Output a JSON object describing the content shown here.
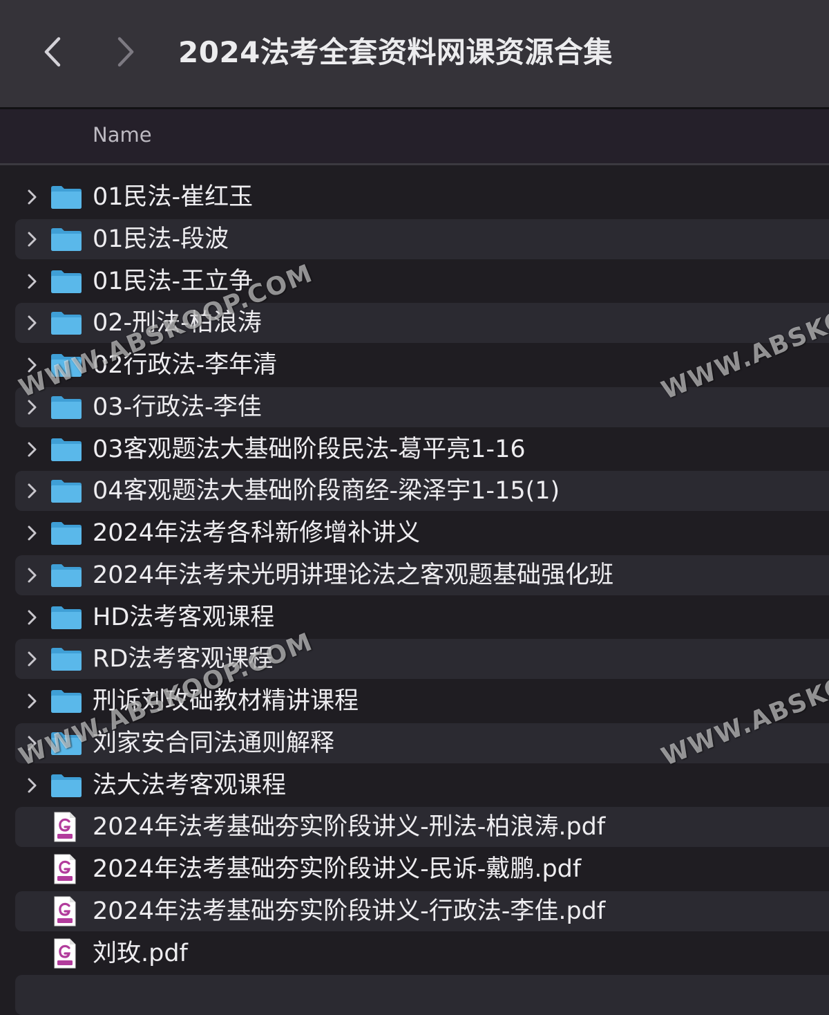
{
  "window": {
    "title": "2024法考全套资料网课资源合集"
  },
  "header": {
    "name_label": "Name"
  },
  "items": [
    {
      "name": "01民法-崔红玉",
      "kind": "folder"
    },
    {
      "name": "01民法-段波",
      "kind": "folder"
    },
    {
      "name": "01民法-王立争",
      "kind": "folder"
    },
    {
      "name": "02-刑法-柏浪涛",
      "kind": "folder"
    },
    {
      "name": "02行政法-李年清",
      "kind": "folder"
    },
    {
      "name": "03-行政法-李佳",
      "kind": "folder"
    },
    {
      "name": "03客观题法大基础阶段民法-葛平亮1-16",
      "kind": "folder"
    },
    {
      "name": "04客观题法大基础阶段商经-梁泽宇1-15(1)",
      "kind": "folder"
    },
    {
      "name": "2024年法考各科新修增补讲义",
      "kind": "folder"
    },
    {
      "name": "2024年法考宋光明讲理论法之客观题基础强化班",
      "kind": "folder"
    },
    {
      "name": "HD法考客观课程",
      "kind": "folder"
    },
    {
      "name": "RD法考客观课程",
      "kind": "folder"
    },
    {
      "name": "刑诉刘玫础教材精讲课程",
      "kind": "folder"
    },
    {
      "name": "刘家安合同法通则解释",
      "kind": "folder"
    },
    {
      "name": "法大法考客观课程",
      "kind": "folder"
    },
    {
      "name": "2024年法考基础夯实阶段讲义-刑法-柏浪涛.pdf",
      "kind": "pdf"
    },
    {
      "name": "2024年法考基础夯实阶段讲义-民诉-戴鹏.pdf",
      "kind": "pdf"
    },
    {
      "name": "2024年法考基础夯实阶段讲义-行政法-李佳.pdf",
      "kind": "pdf"
    },
    {
      "name": "刘玫.pdf",
      "kind": "pdf"
    }
  ],
  "watermarks": [
    "WWW.ABSKOOP.COM",
    "WWW.ABSKO",
    "WWW.ABSKOOP.COM",
    "WWW.ABSKO"
  ],
  "colors": {
    "folder_blue": "#5ab8ea",
    "pdf_purple": "#b23c9c",
    "row_alt": "#2b2a31",
    "background": "#1f1d22"
  }
}
